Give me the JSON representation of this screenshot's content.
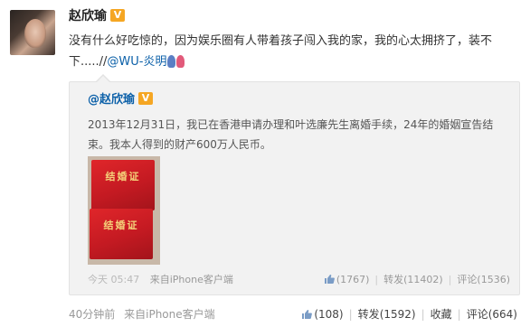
{
  "post": {
    "author": "赵欣瑜",
    "verified_badge": "V",
    "text": "没有什么好吃惊的，因为娱乐圈有人带着孩子闯入我的家，我的心太拥挤了，装不下.....//",
    "mention": "@WU-炎明",
    "time": "40分钟前",
    "source_prefix": "来自",
    "source": "iPhone客户端",
    "likes": "(108)",
    "repost_label": "转发",
    "repost_count": "(1592)",
    "favorite_label": "收藏",
    "comment_label": "评论",
    "comment_count": "(664)"
  },
  "repost": {
    "author": "@赵欣瑜",
    "verified_badge": "V",
    "text": "2013年12月31日，我已在香港申请办理和叶选廉先生离婚手续，24年的婚姻宣告结束。我本人得到的财产600万人民币。",
    "photo_title_top": "结婚证",
    "photo_title_bottom": "结婚证",
    "time": "今天 05:47",
    "source_prefix": "来自",
    "source": "iPhone客户端",
    "likes": "(1767)",
    "repost_label": "转发",
    "repost_count": "(11402)",
    "comment_label": "评论",
    "comment_count": "(1536)"
  },
  "colors": {
    "link": "#0a5fa8",
    "badge": "#f5a623",
    "muted": "#999999"
  }
}
